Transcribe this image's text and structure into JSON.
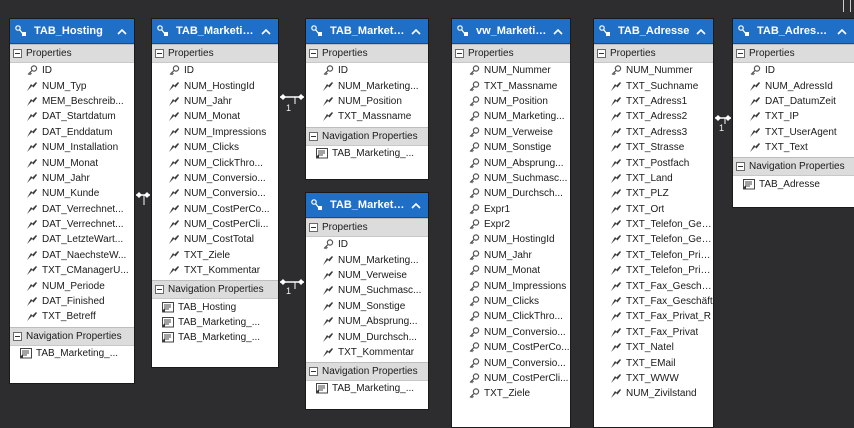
{
  "entities": [
    {
      "name": "TAB_Hosting",
      "properties_label": "Properties",
      "navigation_label": "Navigation Properties",
      "properties": [
        {
          "name": "ID",
          "key": true
        },
        {
          "name": "NUM_Typ"
        },
        {
          "name": "MEM_Beschreib..."
        },
        {
          "name": "DAT_Startdatum"
        },
        {
          "name": "DAT_Enddatum"
        },
        {
          "name": "NUM_Installation"
        },
        {
          "name": "NUM_Monat"
        },
        {
          "name": "NUM_Jahr"
        },
        {
          "name": "NUM_Kunde"
        },
        {
          "name": "DAT_Verrechnet..."
        },
        {
          "name": "DAT_Verrechnet..."
        },
        {
          "name": "DAT_LetzteWart..."
        },
        {
          "name": "DAT_NaechsteW..."
        },
        {
          "name": "TXT_CManagerU..."
        },
        {
          "name": "NUM_Periode"
        },
        {
          "name": "DAT_Finished"
        },
        {
          "name": "TXT_Betreff"
        }
      ],
      "navigation": [
        "TAB_Marketing_..."
      ]
    },
    {
      "name": "TAB_Marketin...",
      "properties_label": "Properties",
      "navigation_label": "Navigation Properties",
      "properties": [
        {
          "name": "ID",
          "key": true
        },
        {
          "name": "NUM_HostingId"
        },
        {
          "name": "NUM_Jahr"
        },
        {
          "name": "NUM_Monat"
        },
        {
          "name": "NUM_Impressions"
        },
        {
          "name": "NUM_Clicks"
        },
        {
          "name": "NUM_ClickThro..."
        },
        {
          "name": "NUM_Conversio..."
        },
        {
          "name": "NUM_Conversio..."
        },
        {
          "name": "NUM_CostPerCo..."
        },
        {
          "name": "NUM_CostPerCli..."
        },
        {
          "name": "NUM_CostTotal"
        },
        {
          "name": "TXT_Ziele"
        },
        {
          "name": "TXT_Kommentar"
        }
      ],
      "navigation": [
        "TAB_Hosting",
        "TAB_Marketing_...",
        "TAB_Marketing_..."
      ]
    },
    {
      "name": "TAB_Marketin...",
      "properties_label": "Properties",
      "navigation_label": "Navigation Properties",
      "properties": [
        {
          "name": "ID",
          "key": true
        },
        {
          "name": "NUM_Marketing..."
        },
        {
          "name": "NUM_Position"
        },
        {
          "name": "TXT_Massname"
        }
      ],
      "navigation": [
        "TAB_Marketing_..."
      ]
    },
    {
      "name": "TAB_Marketin...",
      "properties_label": "Properties",
      "navigation_label": "Navigation Properties",
      "properties": [
        {
          "name": "ID",
          "key": true
        },
        {
          "name": "NUM_Marketing..."
        },
        {
          "name": "NUM_Verweise"
        },
        {
          "name": "NUM_Suchmasc..."
        },
        {
          "name": "NUM_Sonstige"
        },
        {
          "name": "NUM_Absprung..."
        },
        {
          "name": "NUM_Durchsch..."
        },
        {
          "name": "TXT_Kommentar"
        }
      ],
      "navigation": [
        "TAB_Marketing_..."
      ]
    },
    {
      "name": "vw_Marketing",
      "properties_label": "Properties",
      "navigation_label": "",
      "properties": [
        {
          "name": "NUM_Nummer",
          "key": true
        },
        {
          "name": "TXT_Massname",
          "key": true
        },
        {
          "name": "NUM_Position",
          "key": true
        },
        {
          "name": "NUM_Marketing...",
          "key": true
        },
        {
          "name": "NUM_Verweise",
          "key": true
        },
        {
          "name": "NUM_Sonstige",
          "key": true
        },
        {
          "name": "NUM_Absprung...",
          "key": true
        },
        {
          "name": "NUM_Suchmasc...",
          "key": true
        },
        {
          "name": "NUM_Durchsch...",
          "key": true
        },
        {
          "name": "Expr1",
          "key": true
        },
        {
          "name": "Expr2",
          "key": true
        },
        {
          "name": "NUM_HostingId",
          "key": true
        },
        {
          "name": "NUM_Jahr",
          "key": true
        },
        {
          "name": "NUM_Monat",
          "key": true
        },
        {
          "name": "NUM_Impressions",
          "key": true
        },
        {
          "name": "NUM_Clicks",
          "key": true
        },
        {
          "name": "NUM_ClickThro...",
          "key": true
        },
        {
          "name": "NUM_Conversio...",
          "key": true
        },
        {
          "name": "NUM_CostPerCo...",
          "key": true
        },
        {
          "name": "NUM_Conversio...",
          "key": true
        },
        {
          "name": "NUM_CostPerCli...",
          "key": true
        },
        {
          "name": "TXT_Ziele",
          "key": true
        }
      ],
      "navigation": []
    },
    {
      "name": "TAB_Adresse",
      "properties_label": "Properties",
      "navigation_label": "",
      "properties": [
        {
          "name": "NUM_Nummer",
          "key": true
        },
        {
          "name": "TXT_Suchname"
        },
        {
          "name": "TXT_Adress1"
        },
        {
          "name": "TXT_Adress2"
        },
        {
          "name": "TXT_Adress3"
        },
        {
          "name": "TXT_Strasse"
        },
        {
          "name": "TXT_Postfach"
        },
        {
          "name": "TXT_Land"
        },
        {
          "name": "TXT_PLZ"
        },
        {
          "name": "TXT_Ort"
        },
        {
          "name": "TXT_Telefon_Ges..."
        },
        {
          "name": "TXT_Telefon_Ges..."
        },
        {
          "name": "TXT_Telefon_Priv..."
        },
        {
          "name": "TXT_Telefon_Priv..."
        },
        {
          "name": "TXT_Fax_Geschä..."
        },
        {
          "name": "TXT_Fax_Geschäft"
        },
        {
          "name": "TXT_Fax_Privat_R"
        },
        {
          "name": "TXT_Fax_Privat"
        },
        {
          "name": "TXT_Natel"
        },
        {
          "name": "TXT_EMail"
        },
        {
          "name": "TXT_WWW"
        },
        {
          "name": "NUM_Zivilstand"
        }
      ],
      "navigation": []
    },
    {
      "name": "TAB_Adresse_...",
      "properties_label": "Properties",
      "navigation_label": "Navigation Properties",
      "properties": [
        {
          "name": "ID",
          "key": true
        },
        {
          "name": "NUM_AdressId"
        },
        {
          "name": "DAT_DatumZeit"
        },
        {
          "name": "TXT_IP"
        },
        {
          "name": "TXT_UserAgent"
        },
        {
          "name": "TXT_Text"
        }
      ],
      "navigation": [
        "TAB_Adresse"
      ]
    }
  ],
  "association_labels": [
    "1",
    "1",
    "1"
  ],
  "colors": {
    "background": "#2d2d30",
    "header": "#1e6fc5",
    "section": "#dcdcdc",
    "connector": "#ffffff"
  }
}
